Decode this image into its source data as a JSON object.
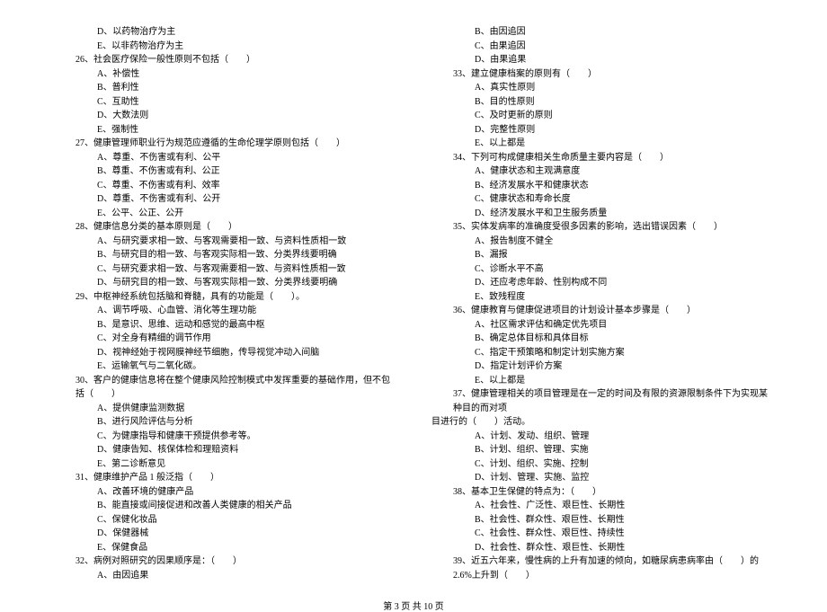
{
  "blank_placeholder": "（　　）",
  "left_column": {
    "orphan_options": [
      {
        "letter": "D",
        "text": "以药物治疗为主"
      },
      {
        "letter": "E",
        "text": "以非药物治疗为主"
      }
    ],
    "questions": [
      {
        "num": "26",
        "stem": "社会医疗保险一般性原则不包括",
        "has_blank": true,
        "options": [
          {
            "letter": "A",
            "text": "补偿性"
          },
          {
            "letter": "B",
            "text": "普利性"
          },
          {
            "letter": "C",
            "text": "互助性"
          },
          {
            "letter": "D",
            "text": "大数法则"
          },
          {
            "letter": "E",
            "text": "强制性"
          }
        ]
      },
      {
        "num": "27",
        "stem": "健康管理师职业行为规范应遵循的生命伦理学原则包括",
        "has_blank": true,
        "options": [
          {
            "letter": "A",
            "text": "尊重、不伤害或有利、公平"
          },
          {
            "letter": "B",
            "text": "尊重、不伤害或有利、公正"
          },
          {
            "letter": "C",
            "text": "尊重、不伤害或有利、效率"
          },
          {
            "letter": "D",
            "text": "尊重、不伤害或有利、公开"
          },
          {
            "letter": "E",
            "text": "公平、公正、公开"
          }
        ]
      },
      {
        "num": "28",
        "stem": "健康信息分类的基本原则是",
        "has_blank": true,
        "options": [
          {
            "letter": "A",
            "text": "与研究要求相一致、与客观需要相一致、与资料性质相一致"
          },
          {
            "letter": "B",
            "text": "与研究目的相一致、与客观实际相一致、分类界线要明确"
          },
          {
            "letter": "C",
            "text": "与研究要求相一致、与客观需要相一致、与资料性质相一致"
          },
          {
            "letter": "D",
            "text": "与研究目的相一致、与客观实际相一致、分类界线要明确"
          }
        ]
      },
      {
        "num": "29",
        "stem": "中枢神经系统包括脑和脊髓，具有的功能是",
        "has_blank": true,
        "tail": "。",
        "options": [
          {
            "letter": "A",
            "text": "调节呼吸、心血管、消化等生理功能"
          },
          {
            "letter": "B",
            "text": "是意识、思维、运动和感觉的最高中枢"
          },
          {
            "letter": "C",
            "text": "对全身有精细的调节作用"
          },
          {
            "letter": "D",
            "text": "视神经始于视网膜神经节细胞，传导视觉冲动入间脑"
          },
          {
            "letter": "E",
            "text": "运输氧气与二氧化碳。"
          }
        ]
      },
      {
        "num": "30",
        "stem": "客户的健康信息将在整个健康风险控制模式中发挥重要的基础作用，但不包括",
        "has_blank": true,
        "options": [
          {
            "letter": "A",
            "text": "提供健康监测数据"
          },
          {
            "letter": "B",
            "text": "进行风险评估与分析"
          },
          {
            "letter": "C",
            "text": "为健康指导和健康干预提供参考等。"
          },
          {
            "letter": "D",
            "text": "健康告知、核保体检和理赔资料"
          },
          {
            "letter": "E",
            "text": "第二诊断意见"
          }
        ]
      },
      {
        "num": "31",
        "stem": "健康维护产品 1 般泛指",
        "has_blank": true,
        "options": [
          {
            "letter": "A",
            "text": "改善环境的健康产品"
          },
          {
            "letter": "B",
            "text": "能直接或间接促进和改善人类健康的相关产品"
          },
          {
            "letter": "C",
            "text": "保健化妆品"
          },
          {
            "letter": "D",
            "text": "保健器械"
          },
          {
            "letter": "E",
            "text": "保健食品"
          }
        ]
      },
      {
        "num": "32",
        "stem": "病例对照研究的因果顺序是：",
        "has_blank": true,
        "options": [
          {
            "letter": "A",
            "text": "由因追果"
          }
        ]
      }
    ]
  },
  "right_column": {
    "orphan_options": [
      {
        "letter": "B",
        "text": "由因追因"
      },
      {
        "letter": "C",
        "text": "由果追因"
      },
      {
        "letter": "D",
        "text": "由果追果"
      }
    ],
    "questions": [
      {
        "num": "33",
        "stem": "建立健康档案的原则有",
        "has_blank": true,
        "options": [
          {
            "letter": "A",
            "text": "真实性原则"
          },
          {
            "letter": "B",
            "text": "目的性原则"
          },
          {
            "letter": "C",
            "text": "及时更新的原则"
          },
          {
            "letter": "D",
            "text": "完整性原则"
          },
          {
            "letter": "E",
            "text": "以上都是"
          }
        ]
      },
      {
        "num": "34",
        "stem": "下列可构成健康相关生命质量主要内容是",
        "has_blank": true,
        "options": [
          {
            "letter": "A",
            "text": "健康状态和主观满意度"
          },
          {
            "letter": "B",
            "text": "经济发展水平和健康状态"
          },
          {
            "letter": "C",
            "text": "健康状态和寿命长度"
          },
          {
            "letter": "D",
            "text": "经济发展水平和卫生服务质量"
          }
        ]
      },
      {
        "num": "35",
        "stem": "实体发病率的准确度受很多因素的影响，选出错误因素",
        "has_blank": true,
        "options": [
          {
            "letter": "A",
            "text": "报告制度不健全"
          },
          {
            "letter": "B",
            "text": "漏报"
          },
          {
            "letter": "C",
            "text": "诊断水平不高"
          },
          {
            "letter": "D",
            "text": "还应考虑年龄、性别构成不同"
          },
          {
            "letter": "E",
            "text": "致残程度"
          }
        ]
      },
      {
        "num": "36",
        "stem": "健康教育与健康促进项目的计划设计基本步骤是",
        "has_blank": true,
        "options": [
          {
            "letter": "A",
            "text": "社区需求评估和确定优先项目"
          },
          {
            "letter": "B",
            "text": "确定总体目标和具体目标"
          },
          {
            "letter": "C",
            "text": "指定干预策略和制定计划实施方案"
          },
          {
            "letter": "D",
            "text": "指定计划评价方案"
          },
          {
            "letter": "E",
            "text": "以上都是"
          }
        ]
      },
      {
        "num": "37",
        "stem_prefix": "健康管理相关的项目管理是在一定的时间及有限的资源限制条件下为实现某种目的而对项",
        "stem_line2": "目进行的",
        "has_blank": true,
        "tail": "活动。",
        "options": [
          {
            "letter": "A",
            "text": "计划、发动、组织、管理"
          },
          {
            "letter": "B",
            "text": "计划、组织、管理、实施"
          },
          {
            "letter": "C",
            "text": "计划、组织、实施、控制"
          },
          {
            "letter": "D",
            "text": "计划、管理、实施、监控"
          }
        ]
      },
      {
        "num": "38",
        "stem": "基本卫生保健的特点为：",
        "has_blank": true,
        "options": [
          {
            "letter": "A",
            "text": "社会性、广泛性、艰巨性、长期性"
          },
          {
            "letter": "B",
            "text": "社会性、群众性、艰巨性、长期性"
          },
          {
            "letter": "C",
            "text": "社会性、群众性、艰巨性、持续性"
          },
          {
            "letter": "D",
            "text": "社会性、群众性、艰巨性、长期性"
          }
        ]
      },
      {
        "num": "39",
        "stem_prefix": "近五六年来，慢性病的上升有加速的倾向，如糖尿病患病率由",
        "has_blank": true,
        "tail_prefix": "的 2.6%上升到",
        "has_blank2": true
      }
    ]
  },
  "footer": {
    "page": "第 3 页 共 10 页"
  }
}
